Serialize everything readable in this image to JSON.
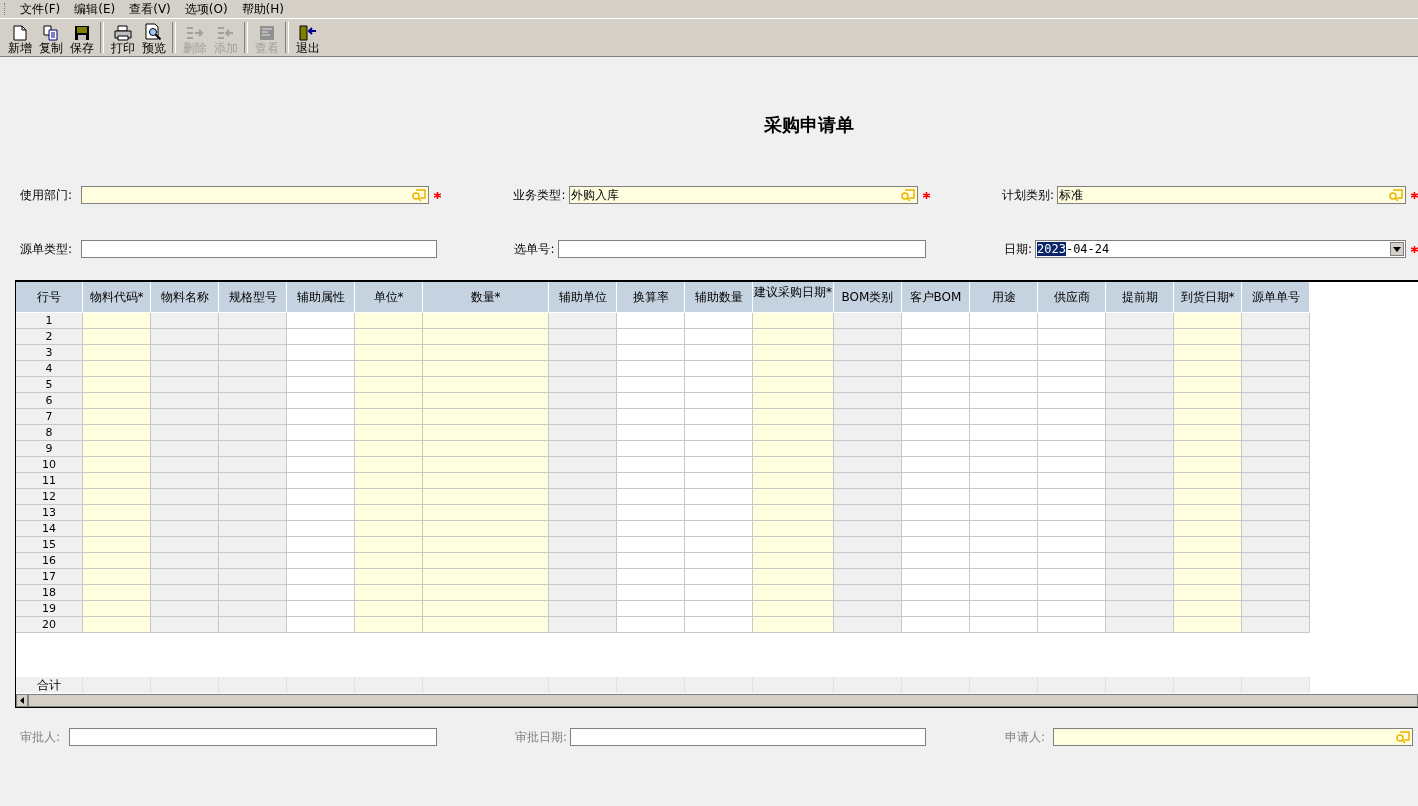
{
  "menu": [
    {
      "label": "文件(F)"
    },
    {
      "label": "编辑(E)"
    },
    {
      "label": "查看(V)"
    },
    {
      "label": "选项(O)"
    },
    {
      "label": "帮助(H)"
    }
  ],
  "toolbar": [
    [
      {
        "label": "新增",
        "kind": "new",
        "disabled": false
      },
      {
        "label": "复制",
        "kind": "copy",
        "disabled": false
      },
      {
        "label": "保存",
        "kind": "save",
        "disabled": false
      }
    ],
    [
      {
        "label": "打印",
        "kind": "print",
        "disabled": false
      },
      {
        "label": "预览",
        "kind": "preview",
        "disabled": false
      }
    ],
    [
      {
        "label": "删除",
        "kind": "delete",
        "disabled": true
      },
      {
        "label": "添加",
        "kind": "add",
        "disabled": true
      }
    ],
    [
      {
        "label": "查看",
        "kind": "view",
        "disabled": true
      }
    ],
    [
      {
        "label": "退出",
        "kind": "exit",
        "disabled": false
      }
    ]
  ],
  "title": "采购申请单",
  "header_fields": [
    [
      {
        "label": "使用部门:",
        "kind": "lookup",
        "required": true
      },
      {
        "label": "业务类型:",
        "kind": "lookup",
        "required": true,
        "value": "外购入库"
      },
      {
        "label": "计划类别:",
        "kind": "lookup",
        "required": true,
        "value": "标准"
      }
    ],
    [
      {
        "label": "源单类型:",
        "kind": "text",
        "required": false
      },
      {
        "label": "选单号:",
        "kind": "text",
        "required": false
      },
      {
        "label": "日期:",
        "kind": "date",
        "required": true,
        "value_selected": "2023",
        "value": "-04-24"
      }
    ]
  ],
  "table": {
    "columns": [
      {
        "label": "行号",
        "kind": "index"
      },
      {
        "label": "物料代码*",
        "kind": "required"
      },
      {
        "label": "物料名称",
        "kind": "readonly"
      },
      {
        "label": "规格型号",
        "kind": "readonly"
      },
      {
        "label": "辅助属性",
        "kind": "editable"
      },
      {
        "label": "单位*",
        "kind": "required"
      },
      {
        "label": "数量*",
        "kind": "required"
      },
      {
        "label": "辅助单位",
        "kind": "readonly"
      },
      {
        "label": "换算率",
        "kind": "editable"
      },
      {
        "label": "辅助数量",
        "kind": "editable"
      },
      {
        "label": "建议采购日期*",
        "kind": "required"
      },
      {
        "label": "BOM类别",
        "kind": "readonly"
      },
      {
        "label": "客户BOM",
        "kind": "editable"
      },
      {
        "label": "用途",
        "kind": "editable"
      },
      {
        "label": "供应商",
        "kind": "editable"
      },
      {
        "label": "提前期",
        "kind": "readonly"
      },
      {
        "label": "到货日期*",
        "kind": "required"
      },
      {
        "label": "源单单号",
        "kind": "readonly"
      }
    ],
    "rows": [
      "1",
      "2",
      "3",
      "4",
      "5",
      "6",
      "7",
      "8",
      "9",
      "10",
      "11",
      "12",
      "13",
      "14",
      "15",
      "16",
      "17",
      "18",
      "19",
      "20"
    ],
    "total_label": "合计"
  },
  "footer_fields": [
    {
      "label": "审批人:",
      "kind": "text",
      "required": false
    },
    {
      "label": "审批日期:",
      "kind": "text",
      "required": false
    },
    {
      "label": "申请人:",
      "kind": "lookup",
      "required": true
    }
  ]
}
